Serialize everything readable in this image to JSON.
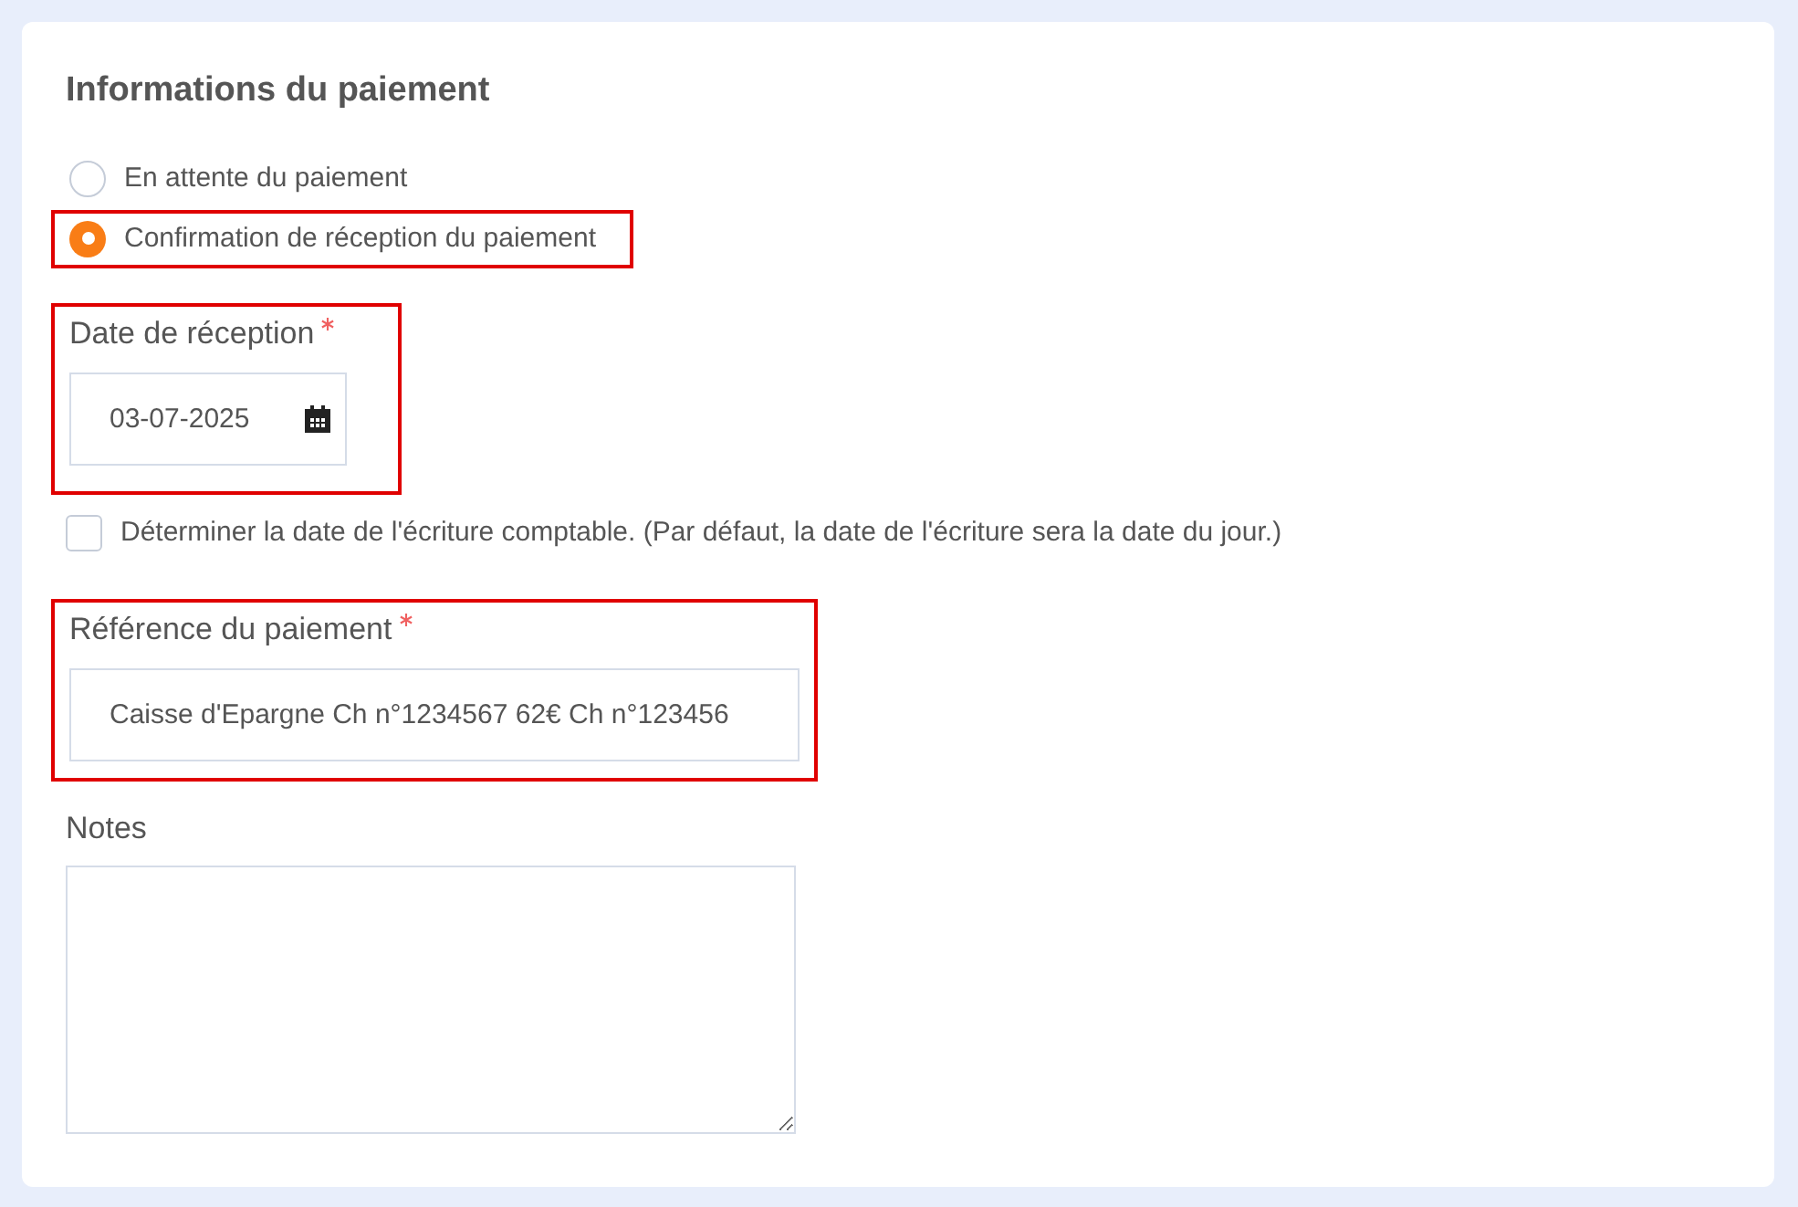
{
  "section": {
    "title": "Informations du paiement"
  },
  "payment_status": [
    {
      "label": "En attente du paiement",
      "selected": false,
      "highlighted": false
    },
    {
      "label": "Confirmation de réception du paiement",
      "selected": true,
      "highlighted": true
    }
  ],
  "date_field": {
    "label": "Date de réception",
    "required": true,
    "value": "03-07-2025",
    "highlighted": true
  },
  "accounting_date": {
    "label": "Déterminer la date de l'écriture comptable. (Par défaut, la date de l'écriture sera la date du jour.)",
    "checked": false
  },
  "reference_field": {
    "label": "Référence du paiement",
    "required": true,
    "value": "Caisse d'Epargne Ch n°1234567 62€ Ch n°123456",
    "highlighted": true
  },
  "notes_field": {
    "label": "Notes"
  }
}
